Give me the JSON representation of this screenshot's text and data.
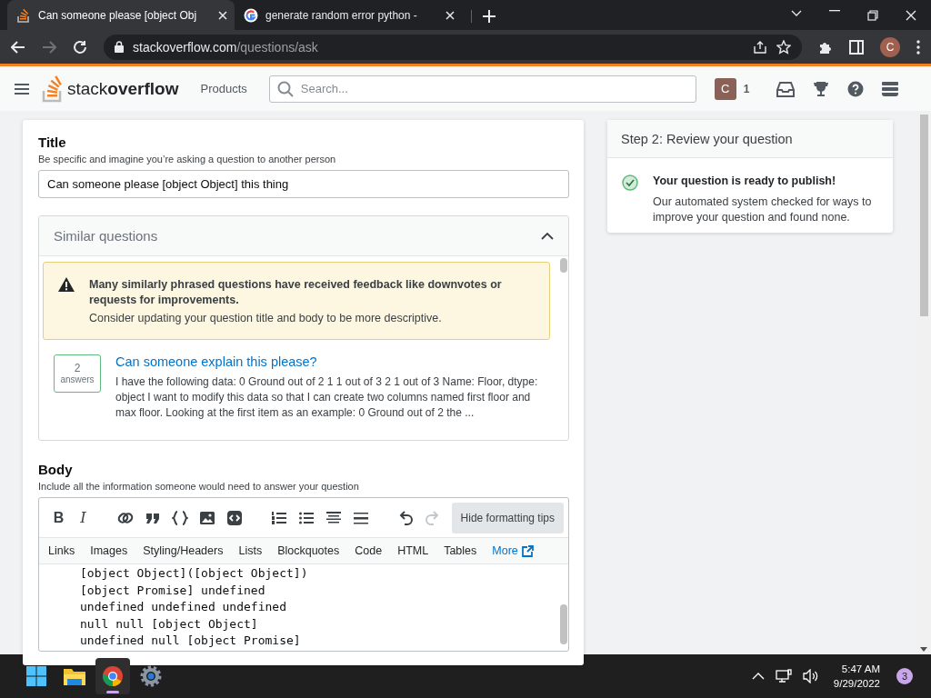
{
  "browser": {
    "tabs": [
      {
        "title": "Can someone please [object Obj",
        "selected": true
      },
      {
        "title": "generate random error python -",
        "selected": false
      }
    ],
    "url": {
      "domain": "stackoverflow.com",
      "path": "/questions/ask"
    },
    "back_disabled": false,
    "forward_disabled": true,
    "profile": "C"
  },
  "site_header": {
    "logo_light": "stack",
    "logo_bold": "overflow",
    "products": "Products",
    "search_placeholder": "Search...",
    "avatar": "C",
    "reputation": "1"
  },
  "title_section": {
    "label": "Title",
    "hint": "Be specific and imagine you’re asking a question to another person",
    "value": "Can someone please [object Object] this thing"
  },
  "similar_questions": {
    "heading": "Similar questions",
    "expanded": true,
    "notice": {
      "title": "Many similarly phrased questions have received feedback like downvotes or requests for improvements.",
      "text": "Consider updating your question title and body to be more descriptive."
    },
    "questions": [
      {
        "answers": "2",
        "answers_label": "answers",
        "title": "Can someone explain this please?",
        "excerpt": "I have the following data: 0 Ground out of 2 1 1 out of 3 2 1 out of 3 Name: Floor, dtype: object I want to modify this data so that I can create two columns named first floor and max floor. Looking at the first item as an example: 0 Ground out of 2 the ..."
      }
    ]
  },
  "body_section": {
    "label": "Body",
    "hint": "Include all the information someone would need to answer your question",
    "toolbar": [
      {
        "kind": "bold",
        "glyph": "B",
        "disabled": false
      },
      {
        "kind": "italic",
        "glyph": "I",
        "disabled": false
      },
      {
        "kind": "link",
        "disabled": false
      },
      {
        "kind": "quote",
        "disabled": false
      },
      {
        "kind": "code",
        "disabled": false
      },
      {
        "kind": "image",
        "disabled": false
      },
      {
        "kind": "snippet",
        "disabled": false
      },
      {
        "kind": "ordered-list",
        "disabled": false
      },
      {
        "kind": "bullet-list",
        "disabled": false
      },
      {
        "kind": "heading",
        "disabled": false
      },
      {
        "kind": "rule",
        "disabled": false
      },
      {
        "kind": "undo",
        "disabled": false
      },
      {
        "kind": "redo",
        "disabled": true
      }
    ],
    "hide_tips": "Hide formatting tips",
    "tips": [
      {
        "label": "Links",
        "kind": "tab"
      },
      {
        "label": "Images",
        "kind": "tab"
      },
      {
        "label": "Styling/Headers",
        "kind": "tab"
      },
      {
        "label": "Lists",
        "kind": "tab"
      },
      {
        "label": "Blockquotes",
        "kind": "tab"
      },
      {
        "label": "Code",
        "kind": "tab"
      },
      {
        "label": "HTML",
        "kind": "tab"
      },
      {
        "label": "Tables",
        "kind": "tab"
      },
      {
        "label": "More",
        "kind": "external"
      }
    ],
    "code_lines": [
      "[object Object]([object Object])",
      "[object Promise] undefined",
      "undefined undefined undefined",
      "null null [object Object]",
      "undefined null [object Promise]"
    ]
  },
  "review": {
    "heading": "Step 2: Review your question",
    "status_title": "Your question is ready to publish!",
    "status_text": "Our automated system checked for ways to improve your question and found none."
  },
  "taskbar": {
    "apps": [
      {
        "kind": "start",
        "selected": false
      },
      {
        "kind": "folder",
        "selected": false
      },
      {
        "kind": "chrome",
        "selected": true
      },
      {
        "kind": "settings",
        "selected": false
      }
    ],
    "time": "5:47 AM",
    "date": "9/29/2022",
    "notifications": "3"
  }
}
